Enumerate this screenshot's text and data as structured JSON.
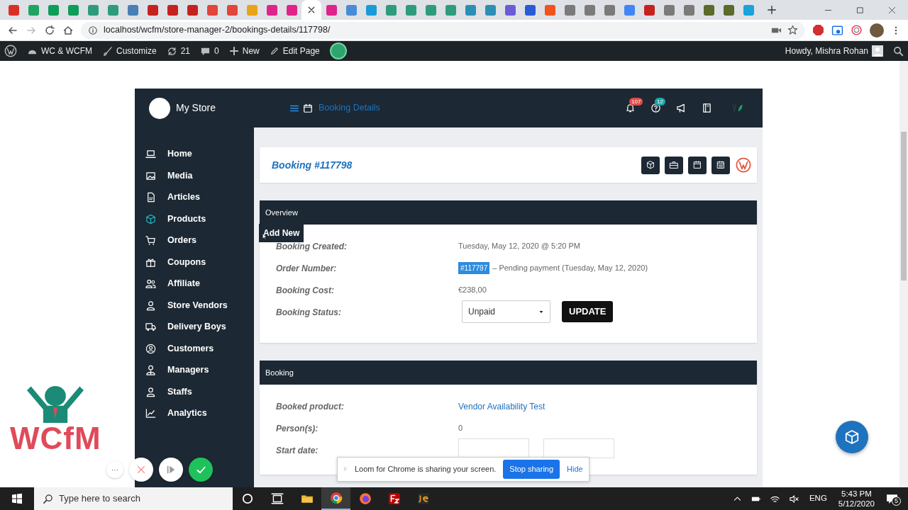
{
  "browser": {
    "tabs": [
      {
        "color": "#d93025",
        "selected": false
      },
      {
        "color": "#1fa463",
        "selected": false
      },
      {
        "color": "#0f9d58",
        "selected": false
      },
      {
        "color": "#0f9d58",
        "selected": false
      },
      {
        "color": "#2e9c7a",
        "selected": false
      },
      {
        "color": "#2e9c7a",
        "selected": false
      },
      {
        "color": "#4a7fb5",
        "selected": false
      },
      {
        "color": "#c5221f",
        "selected": false
      },
      {
        "color": "#c5221f",
        "selected": false
      },
      {
        "color": "#c5221f",
        "selected": false
      },
      {
        "color": "#e2453c",
        "selected": false
      },
      {
        "color": "#e2453c",
        "selected": false
      },
      {
        "color": "#e8a317",
        "selected": false
      },
      {
        "color": "#e0238a",
        "selected": false
      },
      {
        "color": "#e0238a",
        "selected": false
      },
      {
        "selected": true
      },
      {
        "color": "#e0238a",
        "selected": false
      },
      {
        "color": "#4a8bd8",
        "selected": false
      },
      {
        "color": "#1a9bd7",
        "selected": false
      },
      {
        "color": "#2e9c7a",
        "selected": false
      },
      {
        "color": "#2e9c7a",
        "selected": false
      },
      {
        "color": "#2e9c7a",
        "selected": false
      },
      {
        "color": "#2e9c7a",
        "selected": false
      },
      {
        "color": "#2b8fb5",
        "selected": false
      },
      {
        "color": "#2b8fb5",
        "selected": false
      },
      {
        "color": "#6b5bd6",
        "selected": false
      },
      {
        "color": "#2a5bd7",
        "selected": false
      },
      {
        "color": "#f0531c",
        "selected": false
      },
      {
        "color": "#7a7a7a",
        "selected": false
      },
      {
        "color": "#7a7a7a",
        "selected": false
      },
      {
        "color": "#7a7a7a",
        "selected": false
      },
      {
        "color": "#4285f4",
        "selected": false
      },
      {
        "color": "#c5221f",
        "selected": false
      },
      {
        "color": "#7a7a7a",
        "selected": false
      },
      {
        "color": "#7a7a7a",
        "selected": false
      },
      {
        "color": "#5a6b2a",
        "selected": false
      },
      {
        "color": "#5a6b2a",
        "selected": false
      },
      {
        "color": "#1aa3d9",
        "selected": false
      }
    ],
    "url": "localhost/wcfm/store-manager-2/bookings-details/117798/"
  },
  "admin_bar": {
    "site": "WC & WCFM",
    "customize": "Customize",
    "updates": "21",
    "comments": "0",
    "new": "New",
    "edit": "Edit Page",
    "greeting": "Howdy, Mishra Rohan"
  },
  "store": {
    "name": "My Store",
    "page_title": "Booking Details",
    "notifications": "107",
    "inquiries": "12"
  },
  "sidebar": {
    "items": [
      {
        "label": "Home",
        "highlighted": false
      },
      {
        "label": "Media",
        "highlighted": false
      },
      {
        "label": "Articles",
        "highlighted": false
      },
      {
        "label": "Products",
        "highlighted": true
      },
      {
        "label": "Orders",
        "highlighted": false
      },
      {
        "label": "Coupons",
        "highlighted": false
      },
      {
        "label": "Affiliate",
        "highlighted": false
      },
      {
        "label": "Store Vendors",
        "highlighted": false
      },
      {
        "label": "Delivery Boys",
        "highlighted": false
      },
      {
        "label": "Customers",
        "highlighted": false
      },
      {
        "label": "Managers",
        "highlighted": false
      },
      {
        "label": "Staffs",
        "highlighted": false
      },
      {
        "label": "Analytics",
        "highlighted": false
      }
    ]
  },
  "tooltip": "Add New",
  "booking": {
    "title": "Booking #117798",
    "overview": {
      "heading": "Overview",
      "rows": [
        {
          "kind": "text",
          "label": "Booking Created:",
          "value": "Tuesday, May 12, 2020 @ 5:20 PM"
        },
        {
          "kind": "order",
          "label": "Order Number:",
          "order": "#117797",
          "value": "– Pending payment (Tuesday, May 12, 2020)"
        },
        {
          "kind": "text",
          "label": "Booking Cost:",
          "value": "€238,00"
        },
        {
          "kind": "status",
          "label": "Booking Status:",
          "value": "Unpaid",
          "button": "UPDATE"
        }
      ]
    },
    "details": {
      "heading": "Booking",
      "rows": [
        {
          "kind": "link",
          "label": "Booked product:",
          "value": "Vendor Availability Test"
        },
        {
          "kind": "text",
          "label": "Person(s):",
          "value": "0"
        },
        {
          "kind": "fields",
          "label": "Start date:"
        }
      ]
    }
  },
  "logo": "WCfM",
  "loom": {
    "message": "Loom for Chrome is sharing your screen.",
    "stop": "Stop sharing",
    "hide": "Hide",
    "more": "···"
  },
  "taskbar": {
    "search": "Type here to search",
    "language": "ENG",
    "time": "5:43 PM",
    "date": "5/12/2020",
    "notifications": "5"
  }
}
